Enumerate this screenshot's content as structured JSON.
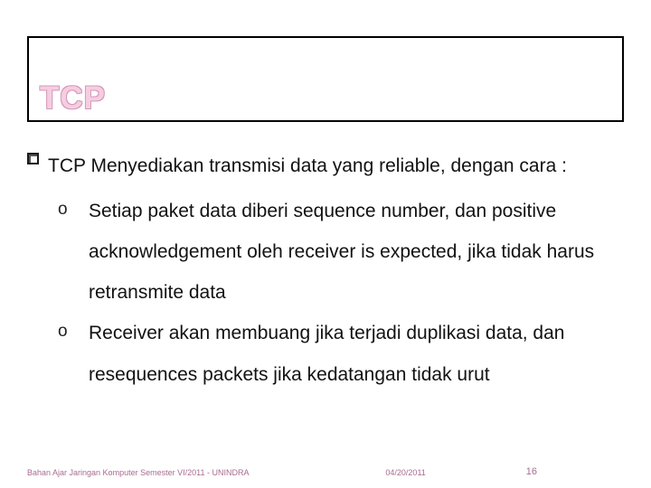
{
  "title": "TCP",
  "bullet": {
    "text": "TCP Menyediakan transmisi data yang reliable, dengan cara :"
  },
  "subitems": [
    "Setiap paket data diberi sequence number, dan positive acknowledgement oleh receiver is expected, jika tidak harus retransmite data",
    "Receiver akan membuang jika terjadi duplikasi data, dan resequences packets jika kedatangan tidak urut"
  ],
  "submarker": "o",
  "footer": {
    "left": "Bahan Ajar Jaringan Komputer Semester VI/2011 - UNINDRA",
    "date": "04/20/2011",
    "page": "16"
  }
}
